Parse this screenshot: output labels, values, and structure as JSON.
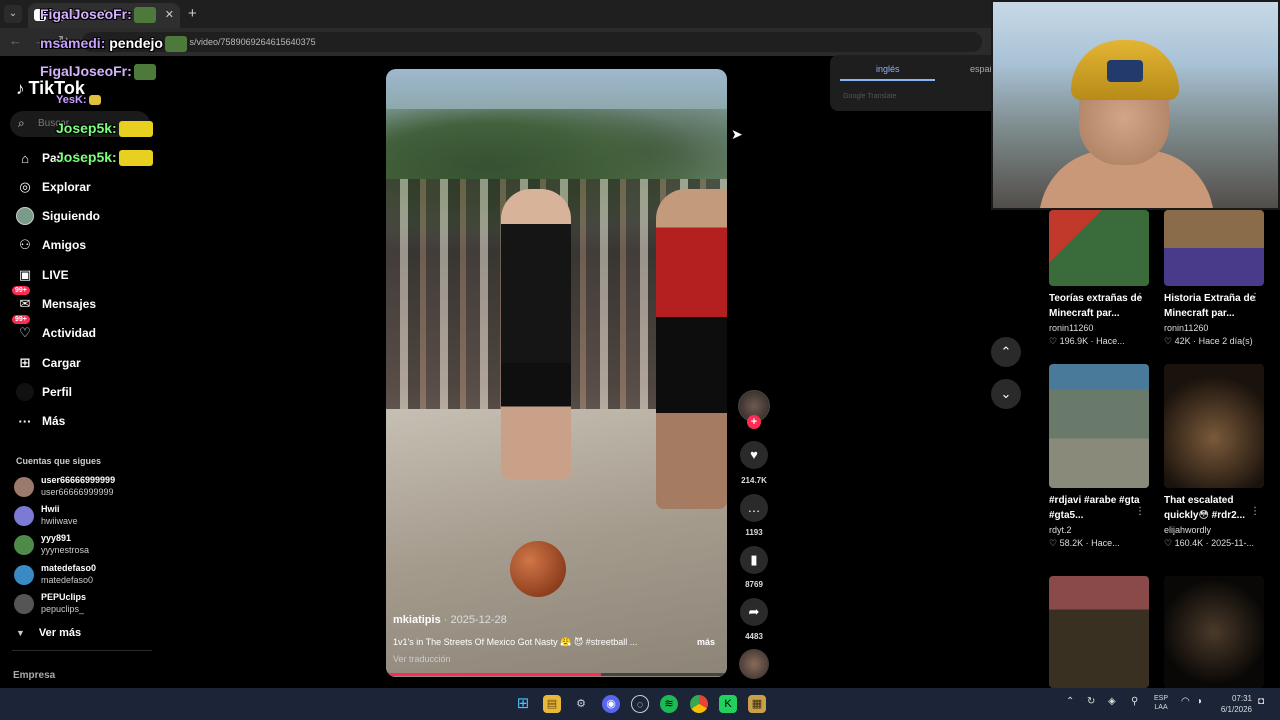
{
  "browser": {
    "tab_title": "FigalJoseoFr:",
    "tab_close": "✕",
    "new_tab": "+",
    "url_prefix": "h",
    "url_path": "s/video/7589069264615640375"
  },
  "sidebar": {
    "logo": "TikTok",
    "search_placeholder": "Buscar",
    "items": [
      {
        "label": "Para ti",
        "icon": "home-icon"
      },
      {
        "label": "Explorar",
        "icon": "compass-icon"
      },
      {
        "label": "Siguiendo",
        "icon": "avatar-icon"
      },
      {
        "label": "Amigos",
        "icon": "friends-icon"
      },
      {
        "label": "LIVE",
        "icon": "live-icon"
      },
      {
        "label": "Mensajes",
        "icon": "messages-icon",
        "badge": "99+"
      },
      {
        "label": "Actividad",
        "icon": "activity-icon",
        "badge": "99+"
      },
      {
        "label": "Cargar",
        "icon": "upload-icon"
      },
      {
        "label": "Perfil",
        "icon": "profile-icon"
      },
      {
        "label": "Más",
        "icon": "more-icon"
      }
    ],
    "following_title": "Cuentas que sigues",
    "following": [
      {
        "name": "user66666999999",
        "handle": "user66666999999",
        "color": "#9a7a6a"
      },
      {
        "name": "Hwii",
        "handle": "hwiiwave",
        "color": "#7b7bd6"
      },
      {
        "name": "yyy891",
        "handle": "yyynestrosa",
        "color": "#4e8a4a"
      },
      {
        "name": "matedefaso0",
        "handle": "matedefaso0",
        "color": "#3a8ac4"
      },
      {
        "name": "PEPUclips",
        "handle": "pepuclips_",
        "color": "#555555"
      }
    ],
    "see_more": "Ver más",
    "footer": "Empresa"
  },
  "chat": [
    {
      "user": "FigalJoseoFr:",
      "color": "#d6b3ff",
      "emote": "#4d7a3a"
    },
    {
      "user": "msamedi:",
      "color": "#c8a0ff",
      "message": "pendejo",
      "emote": "#4d7a3a"
    },
    {
      "user": "FigalJoseoFr:",
      "color": "#d6b3ff",
      "emote": "#4d7a3a"
    },
    {
      "user": "YesK:",
      "color": "#c8a0ff",
      "emote": "#e0c040"
    },
    {
      "user": "Josep5k:",
      "color": "#7cff7c",
      "emote": "#e8d020"
    },
    {
      "user": "Josep5k:",
      "color": "#7cff7c",
      "emote": "#e8d020"
    }
  ],
  "video": {
    "username": "mkiatipis",
    "date": " · 2025-12-28",
    "caption": "1v1's in The Streets Of Mexico Got Nasty 😤 😈 #streetball ...",
    "more": "más",
    "translate": "Ver traducción",
    "progress": 0.63
  },
  "actions": {
    "follow_plus": "+",
    "likes": "214.7K",
    "comments": "1193",
    "saves": "8769",
    "shares": "4483"
  },
  "translate_popup": {
    "lang1": "inglés",
    "lang2": "español",
    "brand": "Google Translate"
  },
  "grid": [
    {
      "title": "Teorías extrañas de Minecraft par...",
      "author": "ronin11260",
      "likes": "196.9K",
      "time": "Hace...",
      "color": "#3a6b3a"
    },
    {
      "title": "Historia Extraña de Minecraft par...",
      "author": "ronin11260",
      "likes": "42K",
      "time": "Hace 2 día(s)",
      "color": "#5a7a4a"
    },
    {
      "title": "#rdjavi #arabe #gta #gta5...",
      "author": "rdyt.2",
      "likes": "58.2K",
      "time": "Hace...",
      "color": "#6a7a6a"
    },
    {
      "title": "That escalated quickly😳 #rdr2...",
      "author": "elijahwordly",
      "likes": "160.4K",
      "time": "2025-11-...",
      "color": "#3a2a22"
    },
    {
      "color": "#3a3022"
    },
    {
      "color": "#1a1410"
    }
  ],
  "taskbar": {
    "lang_line1": "ESP",
    "lang_line2": "LAA",
    "time": "07:31",
    "date": "6/1/2026"
  }
}
